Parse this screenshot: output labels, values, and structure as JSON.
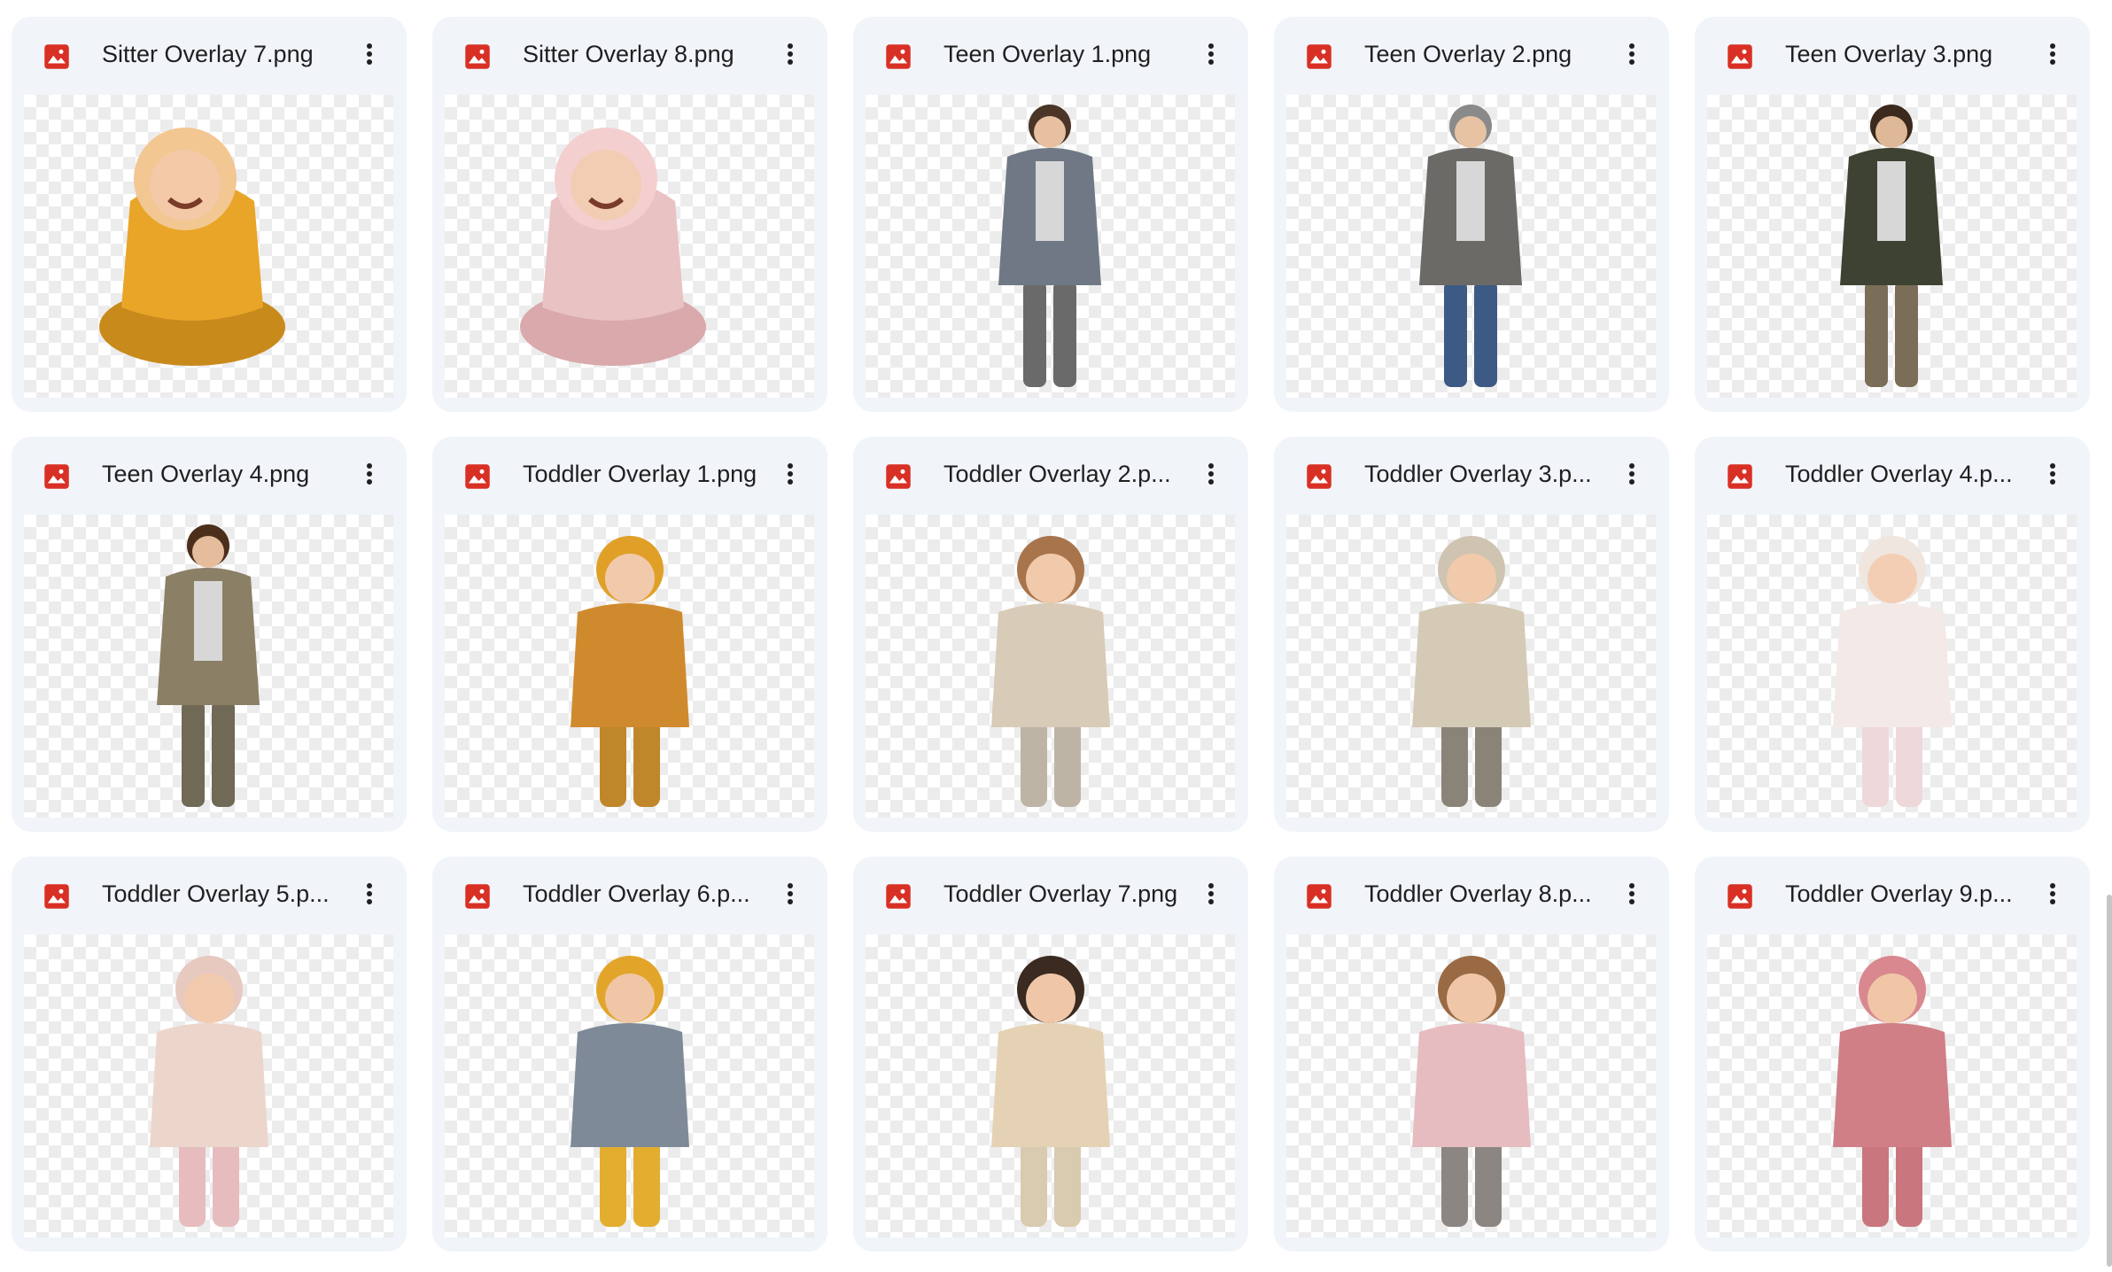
{
  "files": [
    {
      "name": "Sitter Overlay 7.png",
      "type_icon": "image-file-icon",
      "subject": "sitter",
      "colors": {
        "primary": "#e9a528",
        "secondary": "#c98a1c",
        "hair": "#f2c792",
        "skin": "#f3c9a8"
      }
    },
    {
      "name": "Sitter Overlay 8.png",
      "type_icon": "image-file-icon",
      "subject": "sitter",
      "colors": {
        "primary": "#e9c2c4",
        "secondary": "#d9a9ab",
        "hair": "#f4cfcf",
        "skin": "#f3ccb4"
      }
    },
    {
      "name": "Teen Overlay 1.png",
      "type_icon": "image-file-icon",
      "subject": "teen",
      "colors": {
        "primary": "#6f7884",
        "secondary": "#6b6a6a",
        "hair": "#4a3526",
        "skin": "#e6c0a0"
      }
    },
    {
      "name": "Teen Overlay 2.png",
      "type_icon": "image-file-icon",
      "subject": "teen",
      "colors": {
        "primary": "#6c6a66",
        "secondary": "#3d5a85",
        "hair": "#8a8a8a",
        "skin": "#e7c3a4"
      }
    },
    {
      "name": "Teen Overlay 3.png",
      "type_icon": "image-file-icon",
      "subject": "teen",
      "colors": {
        "primary": "#3e4232",
        "secondary": "#7a6e58",
        "hair": "#3b2a1d",
        "skin": "#dfb898"
      }
    },
    {
      "name": "Teen Overlay 4.png",
      "type_icon": "image-file-icon",
      "subject": "teen",
      "colors": {
        "primary": "#8b7f66",
        "secondary": "#6f6955",
        "hair": "#4b2e1c",
        "skin": "#e5bd9c"
      }
    },
    {
      "name": "Toddler Overlay 1.png",
      "type_icon": "image-file-icon",
      "subject": "toddler",
      "colors": {
        "primary": "#d08a2e",
        "secondary": "#c0872a",
        "hair": "#e0a028",
        "skin": "#f1c9ab"
      }
    },
    {
      "name": "Toddler Overlay 2.p...",
      "type_icon": "image-file-icon",
      "subject": "toddler",
      "colors": {
        "primary": "#d8cbb8",
        "secondary": "#bdb4a6",
        "hair": "#a8744c",
        "skin": "#f1c9ab"
      }
    },
    {
      "name": "Toddler Overlay 3.p...",
      "type_icon": "image-file-icon",
      "subject": "toddler",
      "colors": {
        "primary": "#d5cab6",
        "secondary": "#8a8478",
        "hair": "#cfc4b2",
        "skin": "#f1c9ab"
      }
    },
    {
      "name": "Toddler Overlay 4.p...",
      "type_icon": "image-file-icon",
      "subject": "toddler",
      "colors": {
        "primary": "#f3e9e6",
        "secondary": "#efd8da",
        "hair": "#efe6e0",
        "skin": "#f3ceb4"
      }
    },
    {
      "name": "Toddler Overlay 5.p...",
      "type_icon": "image-file-icon",
      "subject": "toddler",
      "colors": {
        "primary": "#ecd6cc",
        "secondary": "#e6bcbf",
        "hair": "#e7c9c0",
        "skin": "#f2cbae"
      }
    },
    {
      "name": "Toddler Overlay 6.p...",
      "type_icon": "image-file-icon",
      "subject": "toddler",
      "colors": {
        "primary": "#7f8a98",
        "secondary": "#e3ad2f",
        "hair": "#e2a52a",
        "skin": "#f0c6a6"
      }
    },
    {
      "name": "Toddler Overlay 7.png",
      "type_icon": "image-file-icon",
      "subject": "toddler",
      "colors": {
        "primary": "#e5d2b4",
        "secondary": "#d9cbb0",
        "hair": "#3a2a20",
        "skin": "#efc7a8"
      }
    },
    {
      "name": "Toddler Overlay 8.p...",
      "type_icon": "image-file-icon",
      "subject": "toddler",
      "colors": {
        "primary": "#e6bcc0",
        "secondary": "#8c8682",
        "hair": "#9a6a44",
        "skin": "#efc7a8"
      }
    },
    {
      "name": "Toddler Overlay 9.p...",
      "type_icon": "image-file-icon",
      "subject": "toddler",
      "colors": {
        "primary": "#d07f86",
        "secondary": "#c9767e",
        "hair": "#d9888f",
        "skin": "#f0c6a6"
      }
    }
  ],
  "more_icon": "more-vert-icon",
  "accent": "#d93025"
}
